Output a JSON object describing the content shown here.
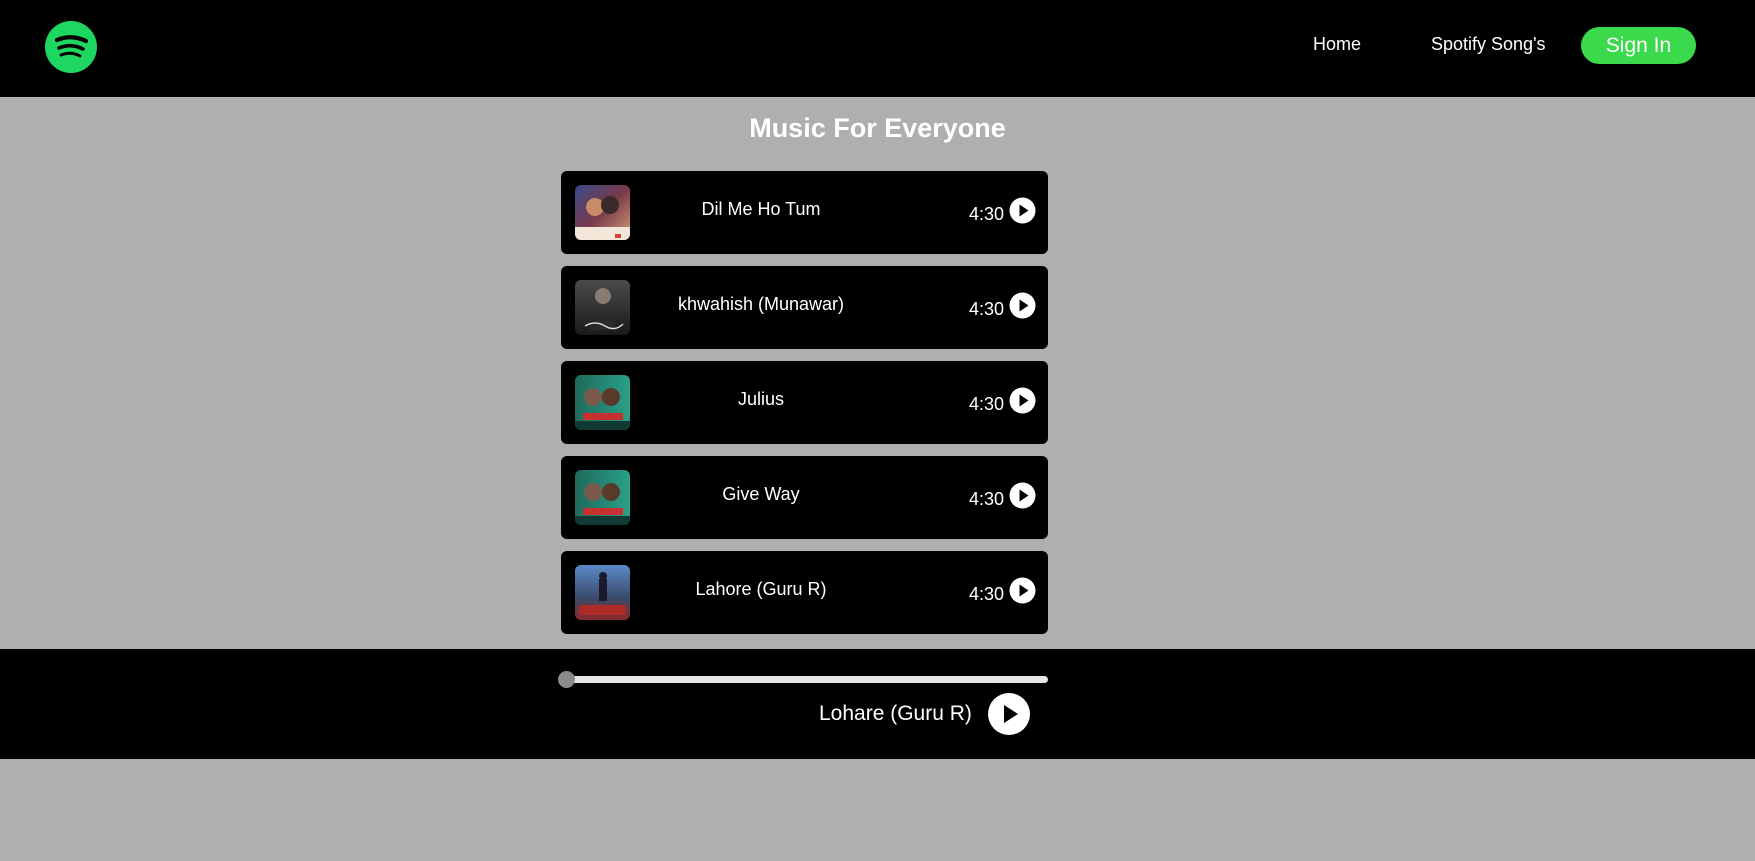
{
  "header": {
    "logo_icon": "spotify-logo-icon",
    "nav": {
      "home_label": "Home",
      "songs_label": "Spotify Song's"
    },
    "signin_label": "Sign In",
    "colors": {
      "brand_green": "#1ed760",
      "signin_green": "#3bd94c"
    }
  },
  "main": {
    "title": "Music For Everyone",
    "songs": [
      {
        "title": "Dil Me Ho Tum",
        "duration": "4:30",
        "icon": "play-circle-icon"
      },
      {
        "title": "khwahish (Munawar)",
        "duration": "4:30",
        "icon": "play-circle-icon"
      },
      {
        "title": "Julius",
        "duration": "4:30",
        "icon": "play-circle-icon"
      },
      {
        "title": "Give Way",
        "duration": "4:30",
        "icon": "play-circle-icon"
      },
      {
        "title": "Lahore (Guru R)",
        "duration": "4:30",
        "icon": "play-circle-icon"
      }
    ]
  },
  "player": {
    "now_playing": "Lohare (Guru R)",
    "progress": 0,
    "play_icon": "play-circle-icon"
  }
}
